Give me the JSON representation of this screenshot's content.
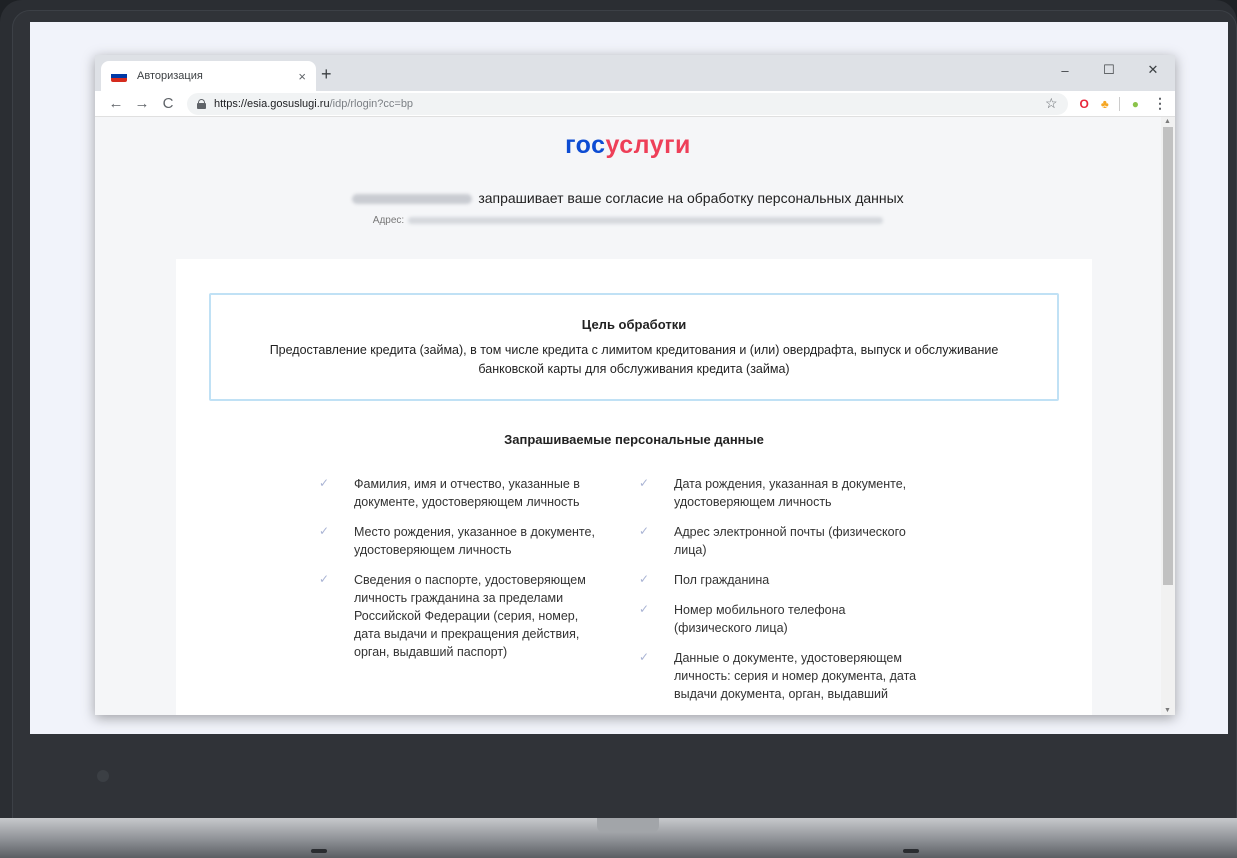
{
  "browser": {
    "tab_title": "Авторизация",
    "tab_close": "×",
    "new_tab": "+",
    "minimize": "–",
    "maximize": "☐",
    "close": "✕",
    "back": "←",
    "forward": "→",
    "reload": "C",
    "url_host": "https://esia.gosuslugi.ru",
    "url_path": "/idp/rlogin?cc=bp",
    "bookmark_icon": "☆",
    "menu": "⋮"
  },
  "page": {
    "logo_part1": "гос",
    "logo_part2": "услуги",
    "consent_text": "запрашивает ваше согласие на обработку персональных данных",
    "address_label": "Адрес:",
    "purpose_title": "Цель обработки",
    "purpose_text": "Предоставление кредита (займа), в том числе кредита с лимитом кредитования и (или) овердрафта, выпуск и обслуживание банковской карты для обслуживания кредита (займа)",
    "requested_title": "Запрашиваемые персональные данные",
    "left_items": [
      "Фамилия, имя и отчество, указанные в документе, удостоверяющем личность",
      "Место рождения, указанное в документе, удостоверяющем личность",
      "Сведения о паспорте, удостоверяющем личность гражданина за пределами Российской Федерации (серия, номер, дата выдачи и прекращения действия, орган, выдавший паспорт)"
    ],
    "right_items": [
      "Дата рождения, указанная в документе, удостоверяющем личность",
      "Адрес электронной почты (физического лица)",
      "Пол гражданина",
      "Номер мобильного телефона (физического лица)",
      "Данные о документе, удостоверяющем личность: серия и номер документа, дата выдачи документа, орган, выдавший"
    ]
  },
  "colors": {
    "logo_blue": "#0d4cd3",
    "logo_red": "#ee3f58",
    "box_border": "#c0e1f5"
  }
}
